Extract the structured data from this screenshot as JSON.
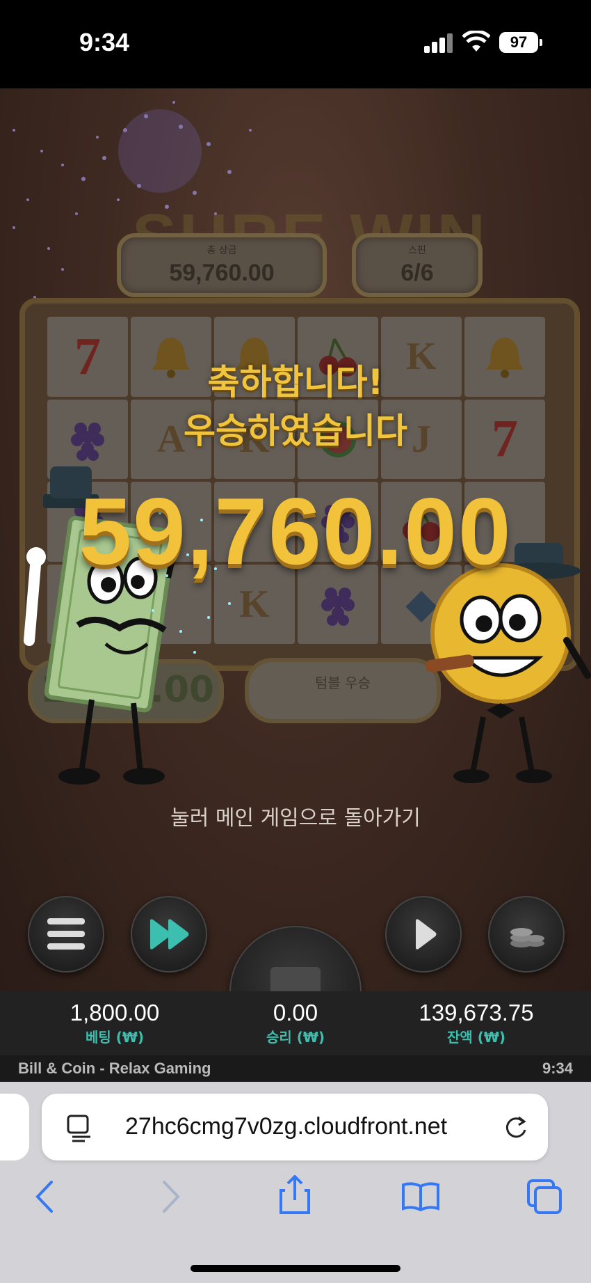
{
  "status_bar": {
    "time": "9:34",
    "battery": "97"
  },
  "game": {
    "title_bg": "SURE WIN",
    "total_win_label": "총 상금",
    "total_win_value": "59,760.00",
    "spins_label": "스핀",
    "spins_value": "6/6",
    "congrats_line1": "축하합니다!",
    "congrats_line2": "우승하였습니다",
    "big_win_amount": "59,760.00",
    "left_mini_value": "2",
    "left_mini_value2": ".00",
    "right_mini_label": "텀블 우승",
    "hint": "눌러 메인 게임으로 돌아가기",
    "grid": [
      [
        "7",
        "bell",
        "bell",
        "cherry",
        "K",
        "bell"
      ],
      [
        "grape",
        "A",
        "K",
        "melon",
        "J",
        "7"
      ],
      [
        "grape",
        "",
        "",
        "grape",
        "cherry",
        ""
      ],
      [
        "",
        "",
        "K",
        "grape",
        "dia",
        ""
      ]
    ]
  },
  "stats": {
    "bet_value": "1,800.00",
    "bet_label": "베팅 (₩)",
    "win_value": "0.00",
    "win_label": "승리 (₩)",
    "balance_value": "139,673.75",
    "balance_label": "잔액 (₩)"
  },
  "footer": {
    "game_name": "Bill & Coin - Relax Gaming",
    "time": "9:34"
  },
  "browser": {
    "url": "27hc6cmg7v0zg.cloudfront.net"
  },
  "colors": {
    "gold": "#f3c23b",
    "teal": "#3cbfae",
    "safari_blue": "#3478f6"
  }
}
